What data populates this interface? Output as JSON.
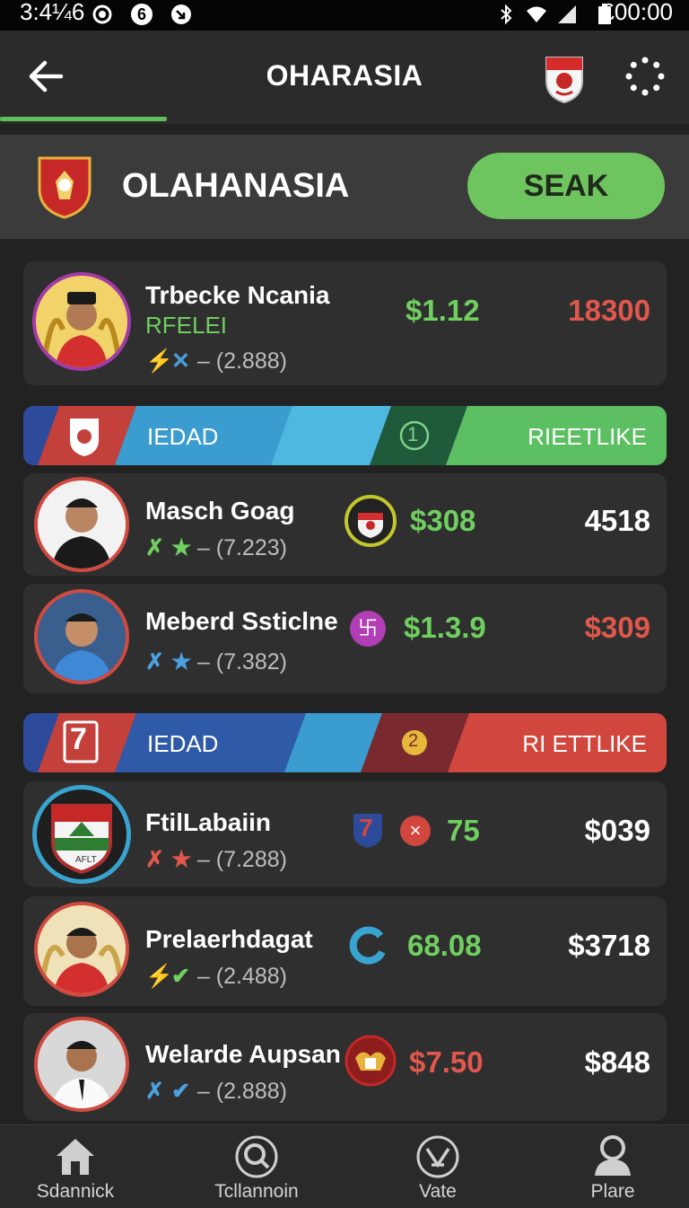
{
  "status_bar": {
    "time": "3:4¼6",
    "clock": "£00:00",
    "badge": "6"
  },
  "app_bar": {
    "title": "OHARASIA"
  },
  "league": {
    "name": "OLAHANASIA",
    "seek_label": "SEAK"
  },
  "players": [
    {
      "name": "Trbecke Ncania",
      "tag": "RFELEI",
      "stats": "– (2.888)",
      "value1": "$1.12",
      "value2": "18300",
      "value1_color": "#6fcf5f",
      "value2_color": "#e0584d"
    },
    {
      "name": "Masch Goag",
      "stats": "– (7.223)",
      "value1": "$308",
      "value2": "4518",
      "value1_color": "#6fcf5f",
      "value2_color": "#ffffff"
    },
    {
      "name": "Meberd Ssticlne",
      "stats": "– (7.382)",
      "value1": "$1.3.9",
      "value2": "$309",
      "value1_color": "#6fcf5f",
      "value2_color": "#e0584d",
      "badge": "卐"
    },
    {
      "name": "FtilLabaiin",
      "stats": "– (7.288)",
      "value1": "75",
      "value2": "$039",
      "value1_color": "#6fcf5f",
      "value2_color": "#ffffff",
      "badge_num": "7",
      "badge_x": "×",
      "crest_text": "AFLT"
    },
    {
      "name": "Prelaerhdagat",
      "stats": "– (2.488)",
      "value1": "68.08",
      "value2": "$3718",
      "value1_color": "#6fcf5f",
      "value2_color": "#ffffff"
    },
    {
      "name": "Welarde Aupsan",
      "stats": "– (2.888)",
      "value1": "$7.50",
      "value2": "$848",
      "value1_color": "#e0584d",
      "value2_color": "#ffffff"
    }
  ],
  "banners": [
    {
      "left": "IEDAD",
      "right": "RIEETLIKE",
      "mid": "1"
    },
    {
      "left": "IEDAD",
      "right": "RI ETTLIKE",
      "mid": "2",
      "badge_num": "7"
    }
  ],
  "nav": [
    {
      "label": "Sdannick",
      "icon": "home-icon"
    },
    {
      "label": "Tcllannoin",
      "icon": "search-icon"
    },
    {
      "label": "Vate",
      "icon": "vote-icon"
    },
    {
      "label": "Plare",
      "icon": "profile-icon"
    }
  ],
  "colors": {
    "accent": "#6ec45f",
    "negative": "#e0584d",
    "background": "#222222",
    "card": "#2f2f2f"
  }
}
